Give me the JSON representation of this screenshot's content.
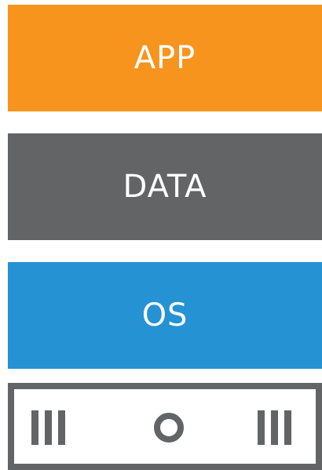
{
  "layers": {
    "app": {
      "label": "APP",
      "color": "#F7941D"
    },
    "data": {
      "label": "DATA",
      "color": "#636466"
    },
    "os": {
      "label": "OS",
      "color": "#2592D3"
    }
  },
  "server": {
    "color": "#636466",
    "icons": [
      "vent-lines-icon",
      "power-circle-icon",
      "vent-lines-icon"
    ]
  }
}
